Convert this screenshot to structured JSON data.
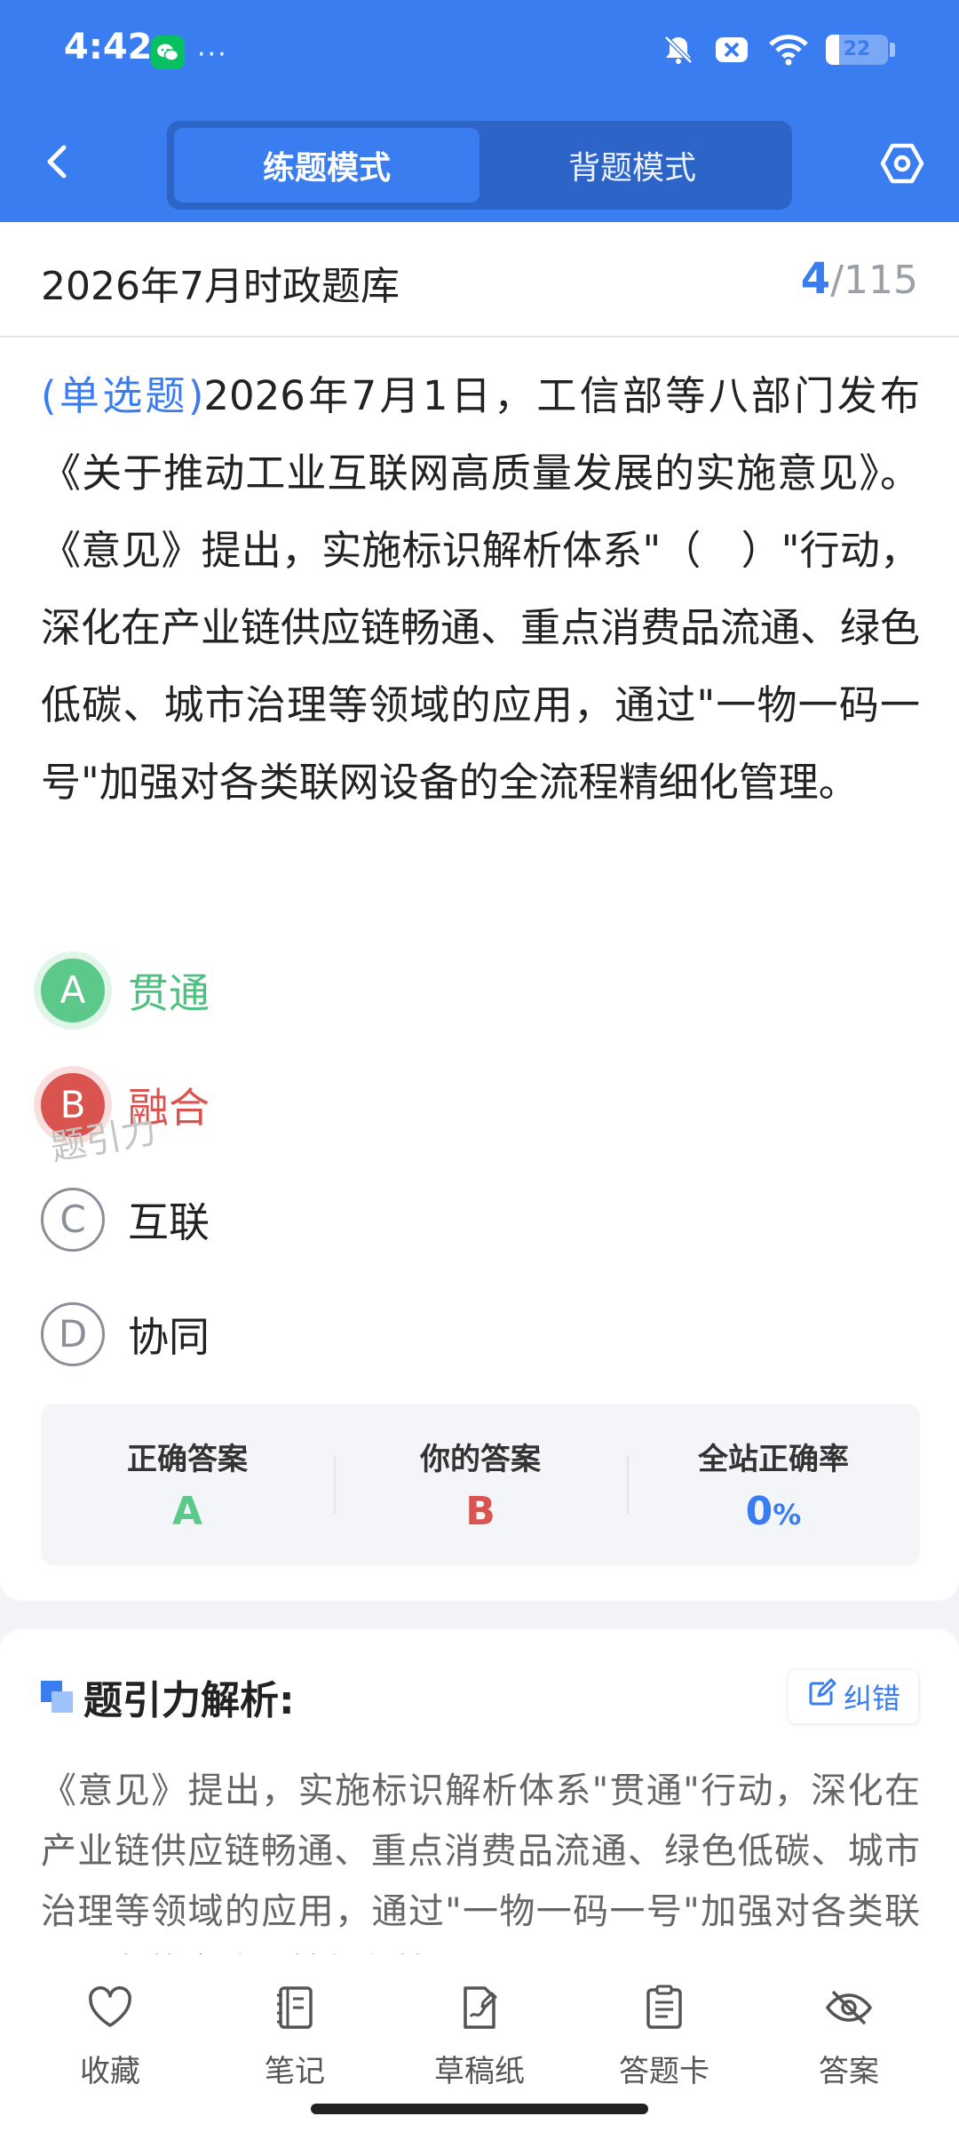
{
  "status_bar": {
    "time": "4:42",
    "more_dots": "···",
    "battery_level": "22"
  },
  "header": {
    "tabs": [
      {
        "label": "练题模式",
        "active": true
      },
      {
        "label": "背题模式",
        "active": false
      }
    ],
    "accent_color": "#3a7df0"
  },
  "title_bar": {
    "bank_title": "2026年7月时政题库",
    "current": "4",
    "separator": "/",
    "total": "115"
  },
  "question": {
    "type": "(单选题)",
    "text": "2026年7月1日，工信部等八部门发布《关于推动工业互联网高质量发展的实施意见》。《意见》提出，实施标识解析体系\"（　）\"行动，深化在产业链供应链畅通、重点消费品流通、绿色低碳、城市治理等领域的应用，通过\"一物一码一号\"加强对各类联网设备的全流程精细化管理。"
  },
  "options": [
    {
      "letter": "A",
      "text": "贯通",
      "state": "correct"
    },
    {
      "letter": "B",
      "text": "融合",
      "state": "wrong"
    },
    {
      "letter": "C",
      "text": "互联",
      "state": "normal"
    },
    {
      "letter": "D",
      "text": "协同",
      "state": "normal"
    }
  ],
  "watermark": "题引力",
  "stats": {
    "correct_label": "正确答案",
    "correct_value": "A",
    "yours_label": "你的答案",
    "yours_value": "B",
    "rate_label": "全站正确率",
    "rate_value": "0",
    "rate_unit": "%"
  },
  "analysis": {
    "title": "题引力解析:",
    "report_label": "纠错",
    "text": "《意见》提出，实施标识解析体系\"贯通\"行动，深化在产业链供应链畅通、重点消费品流通、绿色低碳、城市治理等领域的应用，通过\"一物一码一号\"加强对各类联网设备的全流程精细化管理。"
  },
  "bottom_nav": [
    {
      "label": "收藏",
      "icon": "heart-icon"
    },
    {
      "label": "笔记",
      "icon": "notebook-icon"
    },
    {
      "label": "草稿纸",
      "icon": "draft-icon"
    },
    {
      "label": "答题卡",
      "icon": "clipboard-icon"
    },
    {
      "label": "答案",
      "icon": "eye-off-icon"
    }
  ]
}
